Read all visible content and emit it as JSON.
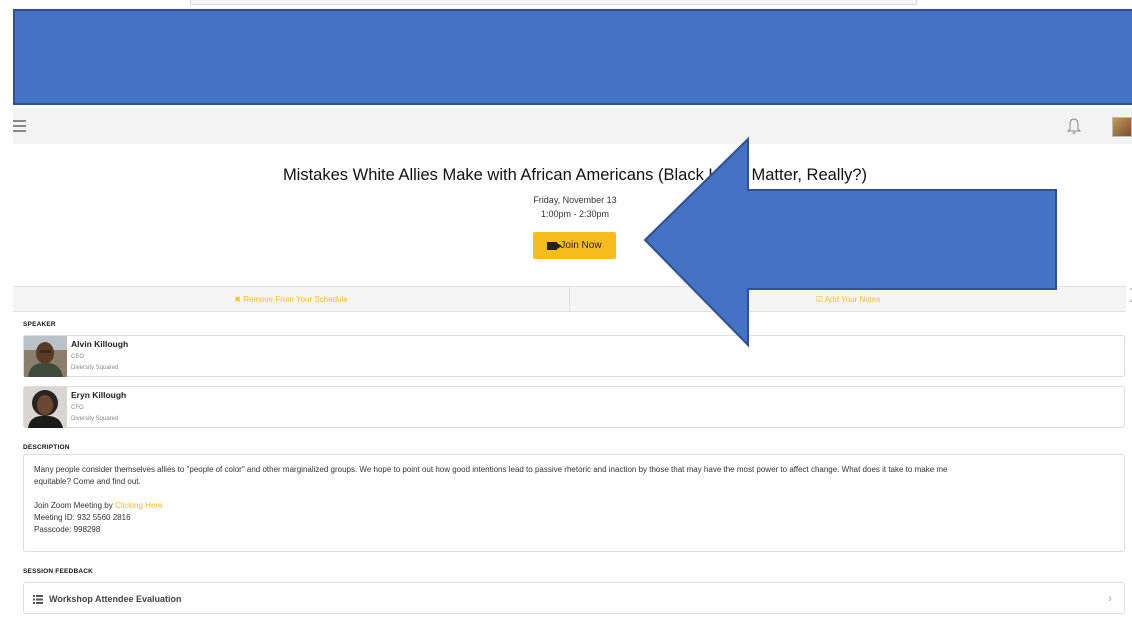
{
  "header": {
    "banner_color": "#4472c4"
  },
  "appbar": {
    "menu_icon": "hamburger-icon",
    "bell_icon": "bell-icon",
    "avatar_icon": "user-avatar"
  },
  "session": {
    "title": "Mistakes White Allies Make with African Americans (Black Lives Matter, Really?)",
    "date": "Friday, November 13",
    "time": "1:00pm - 2:30pm",
    "join_label": "Join Now",
    "join_icon": "video-camera-icon",
    "accent_color": "#f8bc1c"
  },
  "actions": {
    "remove_label": "✖ Remove From Your Schedule",
    "notes_label": "☑ Add Your Notes"
  },
  "speakers_section": {
    "label": "SPEAKER",
    "items": [
      {
        "name": "Alvin Killough",
        "role": "CEO",
        "org": "Diversity Squared"
      },
      {
        "name": "Eryn Killough",
        "role": "CFO",
        "org": "Diversity Squared"
      }
    ]
  },
  "description_section": {
    "label": "DESCRIPTION",
    "line1": "Many people consider themselves allies to \"people of color\" and other marginalized groups. We hope to point out how good intentions lead to passive rhetoric and inaction by those that may have the most power to affect change. What does it take to make me",
    "line2": "equitable? Come and find out.",
    "zoom_prefix": "Join Zoom Meeting by ",
    "zoom_link": "Clicking Here",
    "meeting_id": "Meeting ID: 932 5560 2816",
    "passcode": "Passcode: 998298"
  },
  "feedback_section": {
    "label": "SESSION FEEDBACK",
    "item_label": "Workshop Attendee Evaluation",
    "item_icon": "list-icon",
    "chevron_icon": "chevron-right-icon"
  }
}
